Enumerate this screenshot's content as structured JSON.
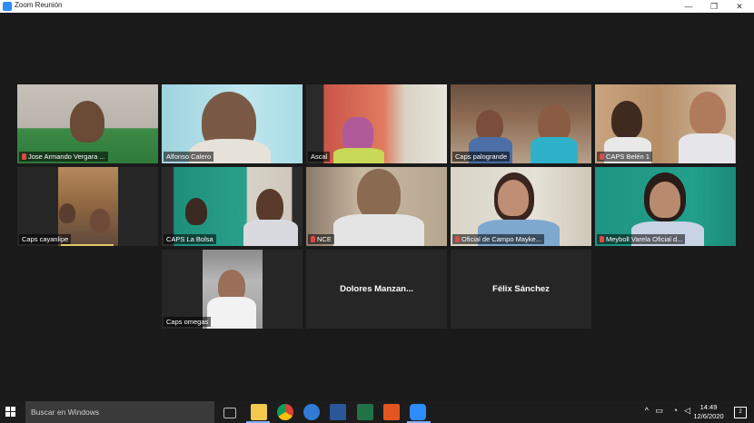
{
  "window": {
    "title": "Zoom Reunión",
    "min": "—",
    "max": "❐",
    "close": "✕"
  },
  "participants": [
    {
      "label": "Jose Armando Vergara ...",
      "muted": true
    },
    {
      "label": "Alfonso Calero",
      "muted": false
    },
    {
      "label": "Ascal",
      "muted": false
    },
    {
      "label": "Caps palogrande",
      "muted": false,
      "active": true
    },
    {
      "label": "CAPS Belén 1",
      "muted": true
    },
    {
      "label": "Caps cayanlipe",
      "muted": false
    },
    {
      "label": "CAPS La Bolsa",
      "muted": false
    },
    {
      "label": "NCE",
      "muted": true
    },
    {
      "label": "Oficial de Campo Mayke...",
      "muted": true
    },
    {
      "label": "Meyboll Varela Oficial d...",
      "muted": true
    },
    {
      "label": "Caps omegas",
      "muted": false
    },
    {
      "label": "Dolores  Manzan...",
      "muted": false
    },
    {
      "label": "Félix Sánchez",
      "muted": false
    }
  ],
  "taskbar": {
    "search_placeholder": "Buscar en Windows",
    "time": "14:49",
    "date": "12/6/2020",
    "notifications": "2",
    "icons": [
      "task-view-icon",
      "file-explorer-icon",
      "chrome-icon",
      "edge-icon",
      "word-icon",
      "excel-icon",
      "office-icon",
      "zoom-icon"
    ]
  }
}
